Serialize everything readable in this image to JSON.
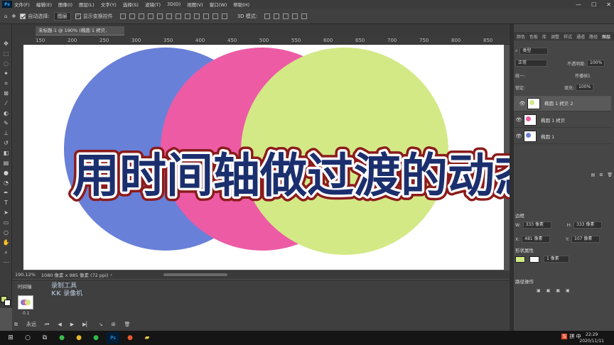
{
  "menubar": {
    "app_badge": "Ps",
    "items": [
      "文件(F)",
      "编辑(E)",
      "图像(I)",
      "图层(L)",
      "文字(Y)",
      "选择(S)",
      "滤镜(T)",
      "3D(D)",
      "视图(V)",
      "窗口(W)",
      "帮助(H)"
    ],
    "window_min": "—",
    "window_max": "☐",
    "window_close": "✕"
  },
  "options_bar": {
    "auto_select_label": "自动选择:",
    "auto_select_value": "图层",
    "show_transform_label": "显示变换控件",
    "mode_3d_label": "3D 模式:"
  },
  "document": {
    "tab_title": "未标题-1 @ 190% (椭圆 1 拷贝, RGB/8#) *",
    "ruler_ticks": [
      "150",
      "200",
      "250",
      "300",
      "350",
      "400",
      "450",
      "500",
      "550",
      "600",
      "650",
      "700",
      "750",
      "800",
      "850"
    ],
    "status_zoom": "190.12%",
    "status_size": "1080 像素 x 985 像素 (72 ppi)",
    "circles": [
      {
        "name": "blue",
        "color": "#6980d8"
      },
      {
        "name": "pink",
        "color": "#ed5ba5"
      },
      {
        "name": "green",
        "color": "#d3e986"
      }
    ]
  },
  "overlay": {
    "title": "用时间轴做过渡的动态",
    "fill": "#1b2f6e",
    "stroke_outer": "#8b1b1b",
    "stroke_inner": "#ffffff"
  },
  "timeline": {
    "title": "时间轴",
    "duration": "0.1",
    "loop_label": "永远",
    "watermark_line1": "录制工具",
    "watermark_line2": "KK 录像机"
  },
  "layers_panel": {
    "tabs": [
      "颜色",
      "色板",
      "库",
      "调整",
      "样式",
      "通道",
      "路径",
      "图层"
    ],
    "active_tab": "图层",
    "filter_label": "类型",
    "blend_mode": "正常",
    "opacity_label": "不透明度:",
    "opacity_value": "100%",
    "unify_label": "统一:",
    "propagate_label": "传播帧1",
    "lock_label": "锁定:",
    "fill_label": "填充:",
    "fill_value": "100%",
    "layers": [
      {
        "name": "椭圆 1 拷贝 2",
        "dot_color": "#d3e986",
        "selected": true
      },
      {
        "name": "椭圆 1 拷贝",
        "dot_color": "#ed5ba5",
        "selected": false
      },
      {
        "name": "椭圆 1",
        "dot_color": "#6980d8",
        "selected": false
      }
    ]
  },
  "properties_panel": {
    "section_shape": "边框",
    "w_label": "W:",
    "w_value": "333 像素",
    "h_label": "H:",
    "h_value": "333 像素",
    "x_label": "X:",
    "x_value": "481 像素",
    "y_label": "Y:",
    "y_value": "107 像素",
    "section_appearance": "形状属性",
    "stroke_value": "1 像素",
    "section_path": "路径操作"
  },
  "taskbar": {
    "ime_label": "拼 中",
    "time": "22:29",
    "date": "2020/11/11"
  }
}
